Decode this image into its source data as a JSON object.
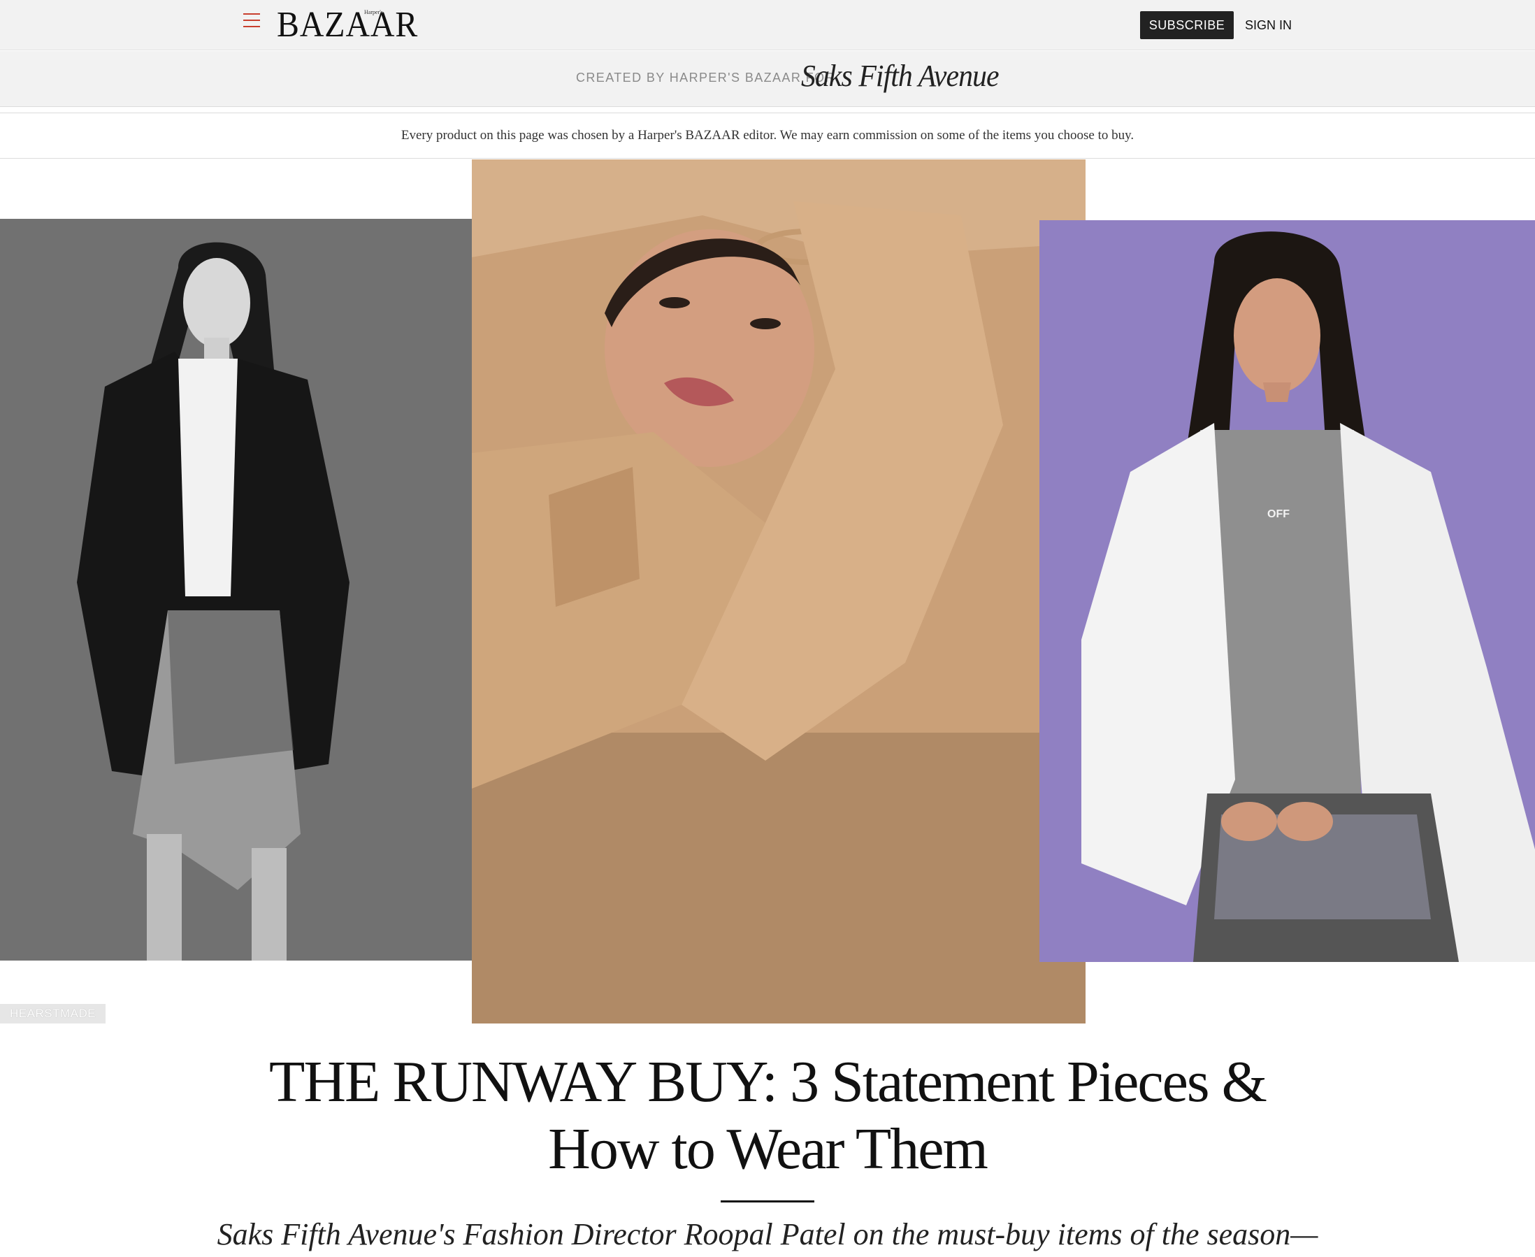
{
  "header": {
    "logo_text": "BAZAAR",
    "logo_small": "Harper's",
    "subscribe_label": "SUBSCRIBE",
    "signin_label": "SIGN IN",
    "accent_color": "#c8402f"
  },
  "sponsor": {
    "created_by": "CREATED BY HARPER'S BAZAAR FOR",
    "partner_logo_text": "Saks Fifth Avenue"
  },
  "disclaimer": "Every product on this page was chosen by a Harper's BAZAAR editor. We may earn commission on some of the items you choose to buy.",
  "hero": {
    "photo_credit": "HEARSTMADE",
    "photos": [
      {
        "name": "black-and-white-leather-jacket-photo"
      },
      {
        "name": "camel-trench-closeup-photo"
      },
      {
        "name": "white-anorak-purple-background-photo",
        "shirt_text": "OFF"
      }
    ]
  },
  "article": {
    "title": "THE RUNWAY BUY: 3 Statement Pieces & How to Wear Them",
    "dek": "Saks Fifth Avenue's Fashion Director Roopal Patel on the must-buy items of the season—"
  }
}
